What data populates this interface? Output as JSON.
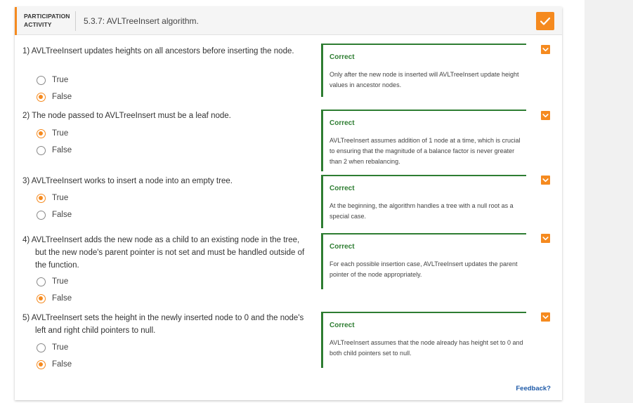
{
  "header": {
    "label_line1": "PARTICIPATION",
    "label_line2": "ACTIVITY",
    "title": "5.3.7: AVLTreeInsert algorithm."
  },
  "questions": [
    {
      "text": "1) AVLTreeInsert updates heights on all ancestors before inserting the node.",
      "options": [
        {
          "label": "True",
          "selected": false
        },
        {
          "label": "False",
          "selected": true
        }
      ],
      "feedback_title": "Correct",
      "feedback_text": "Only after the new node is inserted will AVLTreeInsert update height values in ancestor nodes."
    },
    {
      "text": "2) The node passed to AVLTreeInsert must be a leaf node.",
      "options": [
        {
          "label": "True",
          "selected": true
        },
        {
          "label": "False",
          "selected": false
        }
      ],
      "feedback_title": "Correct",
      "feedback_text": "AVLTreeInsert assumes addition of 1 node at a time, which is crucial to ensuring that the magnitude of a balance factor is never greater than 2 when rebalancing."
    },
    {
      "text": "3) AVLTreeInsert works to insert a node into an empty tree.",
      "options": [
        {
          "label": "True",
          "selected": true
        },
        {
          "label": "False",
          "selected": false
        }
      ],
      "feedback_title": "Correct",
      "feedback_text": "At the beginning, the algorithm handles a tree with a null root as a special case."
    },
    {
      "text": "4) AVLTreeInsert adds the new node as a child to an existing node in the tree, but the new node's parent pointer is not set and must be handled outside of the function.",
      "options": [
        {
          "label": "True",
          "selected": false
        },
        {
          "label": "False",
          "selected": true
        }
      ],
      "feedback_title": "Correct",
      "feedback_text": "For each possible insertion case, AVLTreeInsert updates the parent pointer of the node appropriately."
    },
    {
      "text": "5) AVLTreeInsert sets the height in the newly inserted node to 0 and the node's left and right child pointers to null.",
      "options": [
        {
          "label": "True",
          "selected": false
        },
        {
          "label": "False",
          "selected": true
        }
      ],
      "feedback_title": "Correct",
      "feedback_text": "AVLTreeInsert assumes that the node already has height set to 0 and both child pointers set to null."
    }
  ],
  "feedback_link": "Feedback?",
  "colors": {
    "accent": "#f58a1f",
    "correct": "#2e7d32",
    "link": "#1e5aa8"
  },
  "icons": {
    "completion": "check-icon",
    "question_status": "chevron-down-icon"
  }
}
